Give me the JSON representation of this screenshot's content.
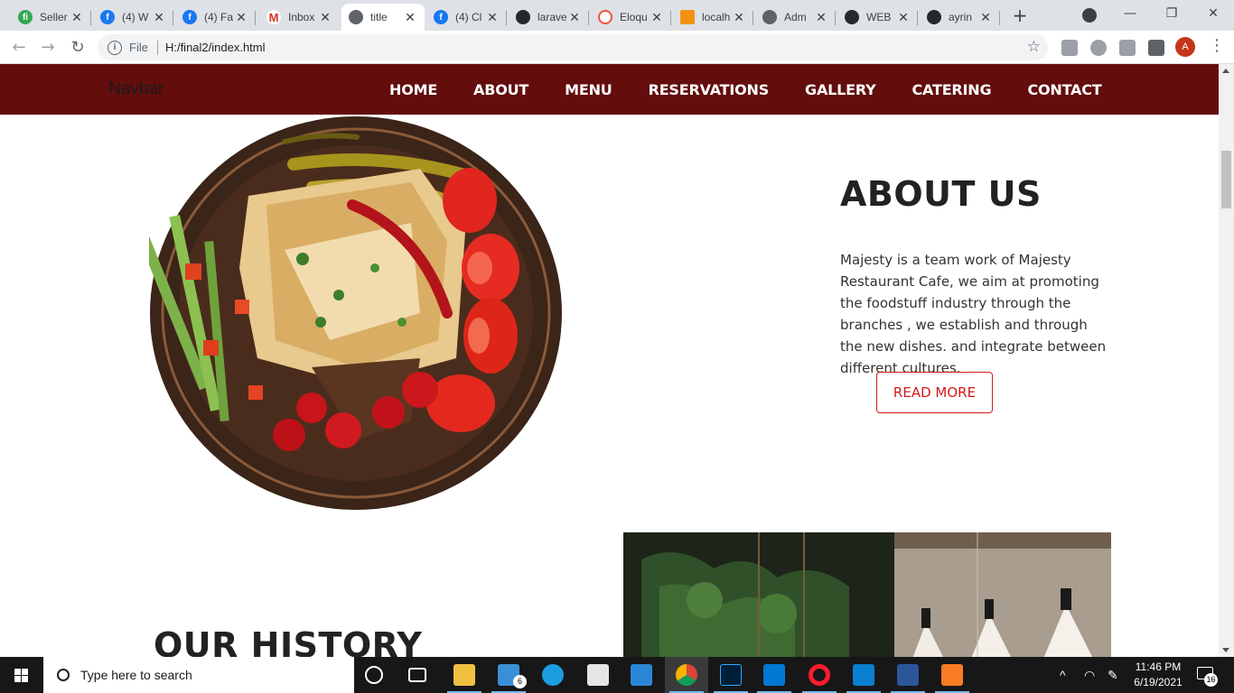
{
  "browser": {
    "tabs": [
      {
        "title": "Seller",
        "icon": "fiverr-icon"
      },
      {
        "title": "(4) W",
        "icon": "facebook-icon"
      },
      {
        "title": "(4) Fa",
        "icon": "facebook-icon"
      },
      {
        "title": "Inbox",
        "icon": "gmail-icon"
      },
      {
        "title": "title",
        "icon": "globe-icon",
        "active": true
      },
      {
        "title": "(4) Cl",
        "icon": "facebook-icon"
      },
      {
        "title": "larave",
        "icon": "github-icon"
      },
      {
        "title": "Eloqu",
        "icon": "laravel-icon"
      },
      {
        "title": "localh",
        "icon": "phpmyadmin-icon"
      },
      {
        "title": "Adm",
        "icon": "globe-icon"
      },
      {
        "title": "WEB",
        "icon": "github-icon"
      },
      {
        "title": "ayrin",
        "icon": "github-icon"
      }
    ],
    "address": {
      "scheme_label": "File",
      "url": "H:/final2/index.html"
    },
    "profile_initial": "A"
  },
  "site": {
    "brand": "Navbar",
    "menu": [
      "HOME",
      "ABOUT",
      "MENU",
      "RESERVATIONS",
      "GALLERY",
      "CATERING",
      "CONTACT"
    ],
    "colors": {
      "nav_bg": "#630d0d",
      "accent": "#d11a1a"
    },
    "about": {
      "title": "ABOUT US",
      "text": "Majesty is a team work of Majesty Restaurant Cafe, we aim at promoting the foodstuff industry through the branches , we establish and through the new dishes. and integrate between different cultures.",
      "button": "READ MORE"
    },
    "history": {
      "title": "OUR HISTORY"
    }
  },
  "taskbar": {
    "search_placeholder": "Type here to search",
    "mail_badge": "6",
    "time": "11:46 PM",
    "date": "6/19/2021",
    "notifications": "16"
  }
}
